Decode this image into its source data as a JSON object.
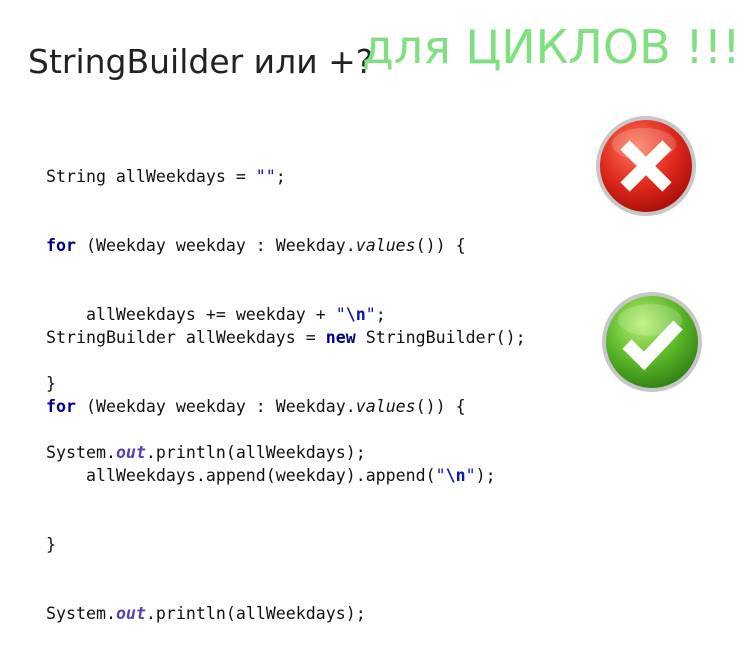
{
  "title": "StringBuilder или +?",
  "note": {
    "text": "для ЦИКЛОВ !!!",
    "color": "#7fe07f"
  },
  "code_bad": {
    "l1_a": "String allWeekdays = ",
    "l1_str": "\"\"",
    "l1_b": ";",
    "l2_kw": "for",
    "l2_a": " (Weekday weekday : Weekday.",
    "l2_it": "values",
    "l2_b": "()) {",
    "l3_a": "    allWeekdays += weekday + ",
    "l3_q1": "\"",
    "l3_esc": "\\n",
    "l3_q2": "\"",
    "l3_b": ";",
    "l4": "}",
    "l5_a": "System.",
    "l5_out": "out",
    "l5_b": ".println(allWeekdays);"
  },
  "code_good": {
    "l1_a": "StringBuilder allWeekdays = ",
    "l1_kw": "new",
    "l1_b": " StringBuilder();",
    "l2_kw": "for",
    "l2_a": " (Weekday weekday : Weekday.",
    "l2_it": "values",
    "l2_b": "()) {",
    "l3_a": "    allWeekdays.append(weekday).append(",
    "l3_q1": "\"",
    "l3_esc": "\\n",
    "l3_q2": "\"",
    "l3_b": ");",
    "l4": "}",
    "l5_a": "System.",
    "l5_out": "out",
    "l5_b": ".println(allWeekdays);"
  },
  "icons": {
    "bad": "cross-icon",
    "good": "check-icon",
    "bad_color": "#e02a1e",
    "good_color": "#5cb82a"
  }
}
